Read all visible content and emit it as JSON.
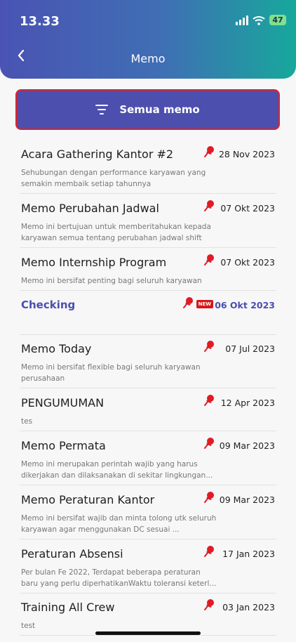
{
  "status": {
    "time": "13.33",
    "battery": "47"
  },
  "header": {
    "title": "Memo"
  },
  "filter": {
    "label": "Semua memo"
  },
  "memos": [
    {
      "title": "Acara Gathering Kantor #2",
      "date": "28 Nov 2023",
      "desc": "Sehubungan dengan performance karyawan yang semakin membaik setiap tahunnya",
      "pinned": true
    },
    {
      "title": "Memo Perubahan Jadwal",
      "date": "07 Okt 2023",
      "desc": "Memo ini bertujuan untuk memberitahukan kepada karyawan semua tentang perubahan jadwal shift",
      "pinned": true
    },
    {
      "title": "Memo Internship Program",
      "date": "07 Okt 2023",
      "desc": "Memo ini bersifat penting bagi seluruh karyawan",
      "pinned": true
    },
    {
      "title": "Checking",
      "date": "06 Okt 2023",
      "desc": "",
      "pinned": true,
      "badge": "NEW",
      "unread": true
    },
    {
      "title": "Memo Today",
      "date": "07 Jul 2023",
      "desc": "Memo ini bersifat flexible bagi seluruh karyawan perusahaan",
      "pinned": true
    },
    {
      "title": "PENGUMUMAN",
      "date": "12 Apr 2023",
      "desc": "tes",
      "pinned": true
    },
    {
      "title": "Memo Permata",
      "date": "09 Mar 2023",
      "desc": "Memo ini merupakan perintah wajib yang harus dikerjakan dan dilaksanakan di sekitar lingkungan...",
      "pinned": true
    },
    {
      "title": "Memo Peraturan Kantor",
      "date": "09 Mar 2023",
      "desc": "Memo ini bersifat wajib dan minta tolong utk seluruh karyawan agar menggunakan DC sesuai ...",
      "pinned": true
    },
    {
      "title": "Peraturan Absensi",
      "date": "17 Jan 2023",
      "desc": "Per bulan Fe  2022, Terdapat beberapa peraturan baru yang perlu diperhatikanWaktu toleransi keterl...",
      "pinned": true
    },
    {
      "title": "Training All Crew",
      "date": "03 Jan 2023",
      "desc": "test",
      "pinned": true
    }
  ],
  "colors": {
    "accent": "#4d4fae",
    "pin": "#e01b24",
    "badge": "#d81818"
  }
}
